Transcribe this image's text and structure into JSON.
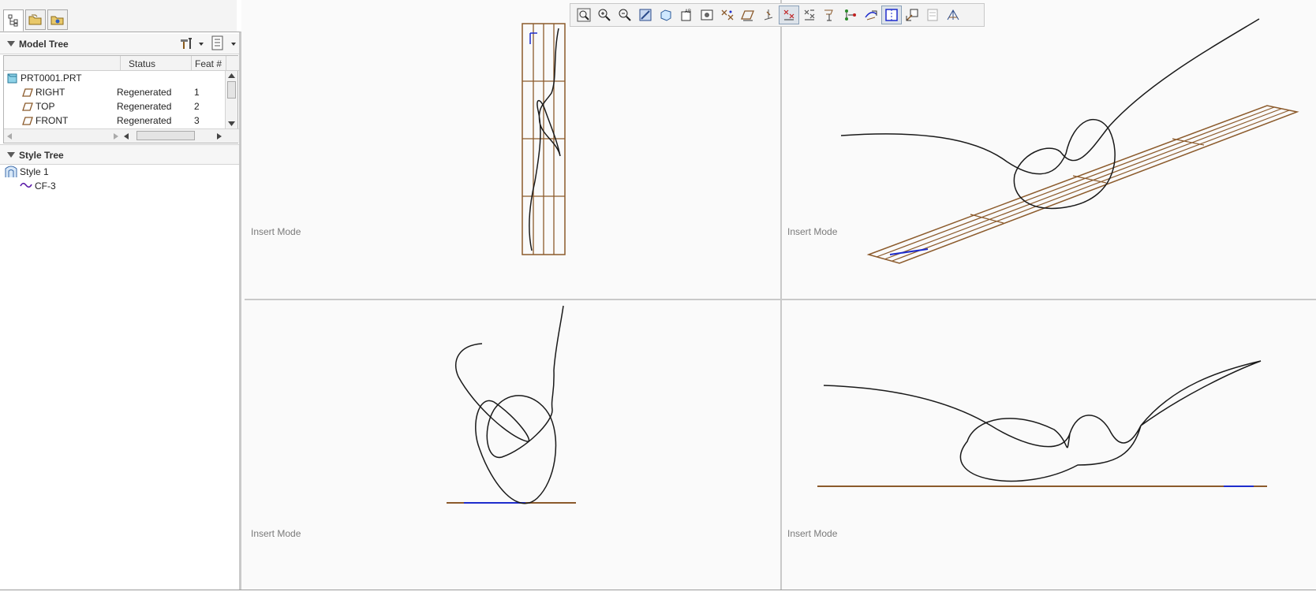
{
  "colors": {
    "plane": "#8b5a2b",
    "curve": "#1a1a1a",
    "selection": "#1e2ccc",
    "divider": "#c9c9c9"
  },
  "left_tabs": [
    {
      "icon": "model-tree-tab-icon"
    },
    {
      "icon": "folder-browser-tab-icon"
    },
    {
      "icon": "favorites-tab-icon"
    }
  ],
  "model_tree": {
    "title": "Model Tree",
    "columns": {
      "name": "",
      "status": "Status",
      "feat": "Feat #"
    },
    "root": "PRT0001.PRT",
    "rows": [
      {
        "name": "RIGHT",
        "status": "Regenerated",
        "feat": "1"
      },
      {
        "name": "TOP",
        "status": "Regenerated",
        "feat": "2"
      },
      {
        "name": "FRONT",
        "status": "Regenerated",
        "feat": "3"
      }
    ]
  },
  "style_tree": {
    "title": "Style Tree",
    "style": "Style 1",
    "curve": "CF-3"
  },
  "viewports": [
    {
      "mode": "Insert Mode"
    },
    {
      "mode": "Insert Mode"
    },
    {
      "mode": "Insert Mode"
    },
    {
      "mode": "Insert Mode"
    }
  ],
  "toolbar": {
    "icons": [
      "refit-icon",
      "zoom-in-icon",
      "zoom-out-icon",
      "repaint-icon",
      "shading-icon",
      "saved-views-icon",
      "view-manager-icon",
      "datum-display-icon",
      "plane-display-icon",
      "point-display-icon",
      "csys-display-icon",
      "axis-display-icon",
      "curve-display-icon",
      "connectivity-icon",
      "surface-display-icon",
      "active-plane-icon",
      "next-view-icon",
      "previous-view-icon",
      "grid-icon"
    ]
  }
}
